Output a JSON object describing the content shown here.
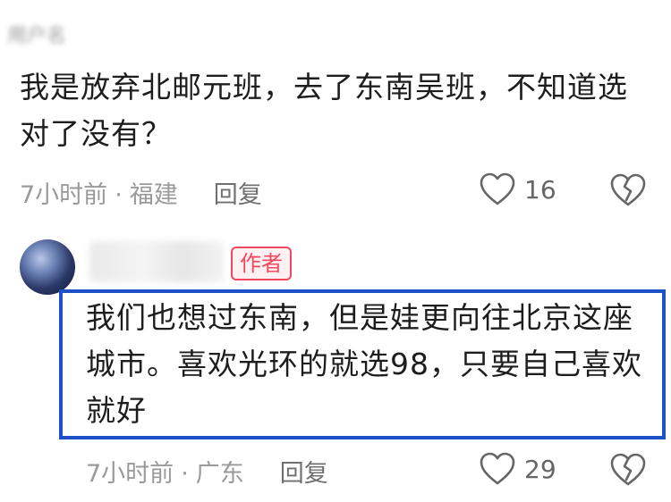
{
  "comment1": {
    "username": "用户名",
    "text": "我是放弃北邮元班，去了东南吴班，不知道选对了没有？",
    "time": "7小时前",
    "location": "福建",
    "reply_label": "回复",
    "likes": "16"
  },
  "comment2": {
    "badge": "作者",
    "text": "我们也想过东南，但是娃更向往北京这座城市。喜欢光环的就选98，只要自己喜欢就好",
    "time": "7小时前",
    "location": "广东",
    "reply_label": "回复",
    "likes": "29"
  },
  "separator": "·",
  "highlight_color": "#1e50c8",
  "badge_color": "#f2485f"
}
